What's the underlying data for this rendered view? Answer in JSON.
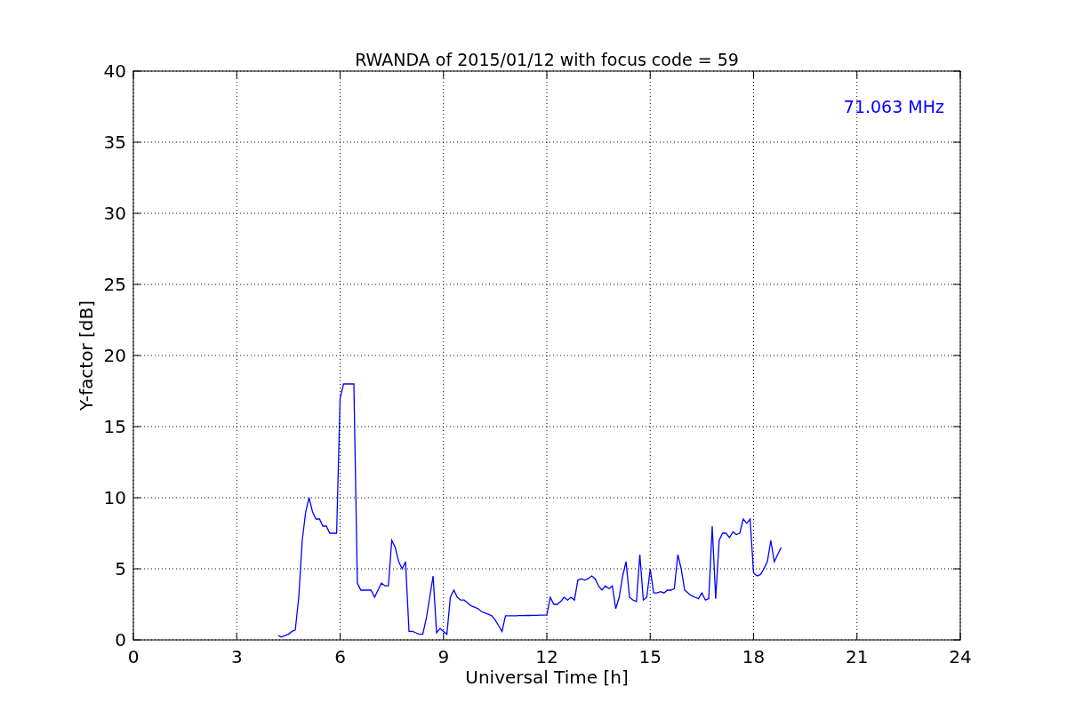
{
  "chart_data": {
    "type": "line",
    "title": "RWANDA of 2015/01/12 with focus code = 59",
    "xlabel": "Universal Time [h]",
    "ylabel": "Y-factor [dB]",
    "xlim": [
      0,
      24
    ],
    "ylim": [
      0,
      40
    ],
    "xticks": [
      0,
      3,
      6,
      9,
      12,
      15,
      18,
      21,
      24
    ],
    "yticks": [
      0,
      5,
      10,
      15,
      20,
      25,
      30,
      35,
      40
    ],
    "x": [
      4.2,
      4.3,
      4.4,
      4.5,
      4.6,
      4.7,
      4.8,
      4.9,
      5.0,
      5.1,
      5.2,
      5.3,
      5.4,
      5.5,
      5.6,
      5.7,
      5.8,
      5.9,
      6.0,
      6.1,
      6.2,
      6.3,
      6.4,
      6.5,
      6.6,
      6.7,
      6.8,
      6.9,
      7.0,
      7.1,
      7.2,
      7.3,
      7.4,
      7.5,
      7.6,
      7.7,
      7.8,
      7.9,
      8.0,
      8.1,
      8.2,
      8.3,
      8.4,
      8.5,
      8.6,
      8.7,
      8.8,
      8.9,
      9.0,
      9.1,
      9.2,
      9.3,
      9.4,
      9.5,
      9.6,
      9.7,
      9.8,
      9.9,
      10.0,
      10.1,
      10.2,
      10.3,
      10.4,
      10.5,
      10.6,
      10.7,
      10.8,
      10.9,
      11.0,
      11.1,
      11.2,
      11.3,
      11.4,
      11.5,
      11.6,
      11.7,
      11.8,
      11.9,
      12.0,
      12.1,
      12.2,
      12.3,
      12.4,
      12.5,
      12.6,
      12.7,
      12.8,
      12.9,
      13.0,
      13.1,
      13.2,
      13.3,
      13.4,
      13.5,
      13.6,
      13.7,
      13.8,
      13.9,
      14.0,
      14.1,
      14.2,
      14.3,
      14.4,
      14.5,
      14.6,
      14.7,
      14.8,
      14.9,
      15.0,
      15.1,
      15.2,
      15.3,
      15.4,
      15.5,
      15.6,
      15.7,
      15.8,
      15.9,
      16.0,
      16.1,
      16.2,
      16.3,
      16.4,
      16.5,
      16.6,
      16.7,
      16.8,
      16.9,
      17.0,
      17.1,
      17.2,
      17.3,
      17.4,
      17.5,
      17.6,
      17.7,
      17.8,
      17.9,
      18.0,
      18.1,
      18.2,
      18.3,
      18.4,
      18.5,
      18.6,
      18.7,
      18.8
    ],
    "series": [
      {
        "color": "#0000ff",
        "values": [
          0.3,
          0.2,
          0.3,
          0.4,
          0.6,
          0.7,
          3,
          7,
          9,
          10,
          9,
          8.5,
          8.5,
          8,
          8,
          7.5,
          7.5,
          7.5,
          17,
          18,
          18,
          18,
          18,
          4,
          3.5,
          3.5,
          3.5,
          3.5,
          3,
          3.5,
          4,
          3.8,
          3.8,
          7,
          6.5,
          5.5,
          5,
          5.5,
          0.6,
          0.6,
          0.5,
          0.4,
          0.4,
          1.5,
          3,
          4.5,
          0.5,
          0.8,
          0.6,
          0.4,
          3,
          3.5,
          3,
          2.8,
          2.8,
          2.6,
          2.4,
          2.3,
          2.2,
          2,
          1.9,
          1.8,
          1.7,
          1.4,
          1,
          0.6,
          1.7,
          1.7,
          1.7,
          1.7,
          1.71,
          1.71,
          1.72,
          1.72,
          1.73,
          1.73,
          1.74,
          1.74,
          1.75,
          3,
          2.5,
          2.5,
          2.7,
          3,
          2.8,
          3,
          2.8,
          4.2,
          4.3,
          4.2,
          4.3,
          4.5,
          4.3,
          3.8,
          3.5,
          3.8,
          3.6,
          3.8,
          2.2,
          3,
          4.5,
          5.5,
          3,
          2.8,
          2.7,
          6,
          2.8,
          3,
          5,
          3.3,
          3.3,
          3.4,
          3.3,
          3.5,
          3.5,
          3.6,
          6,
          5,
          3.5,
          3.3,
          3.1,
          3,
          2.9,
          3.3,
          2.8,
          2.9,
          8,
          2.9,
          7,
          7.5,
          7.5,
          7.2,
          7.6,
          7.4,
          7.5,
          8.5,
          8.2,
          8.5,
          4.7,
          4.5,
          4.6,
          5,
          5.5,
          7,
          5.5,
          6,
          6.5
        ]
      }
    ],
    "grid": true,
    "annotations": [
      "71.063 MHz"
    ]
  }
}
